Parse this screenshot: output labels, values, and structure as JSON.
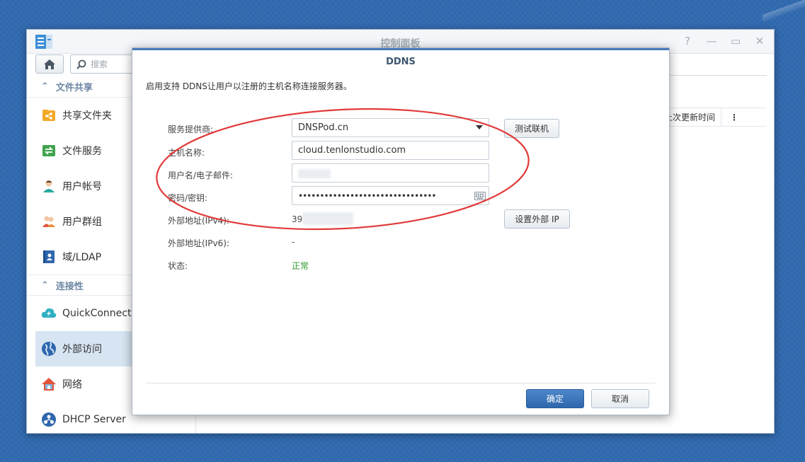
{
  "window": {
    "title": "控制面板",
    "controls": {
      "help": "?",
      "minimize": "—",
      "maximize": "▭",
      "close": "✕"
    }
  },
  "toolbar": {
    "home_icon": "home-icon",
    "search_placeholder": "搜索"
  },
  "sidebar": {
    "sections": [
      {
        "label": "文件共享",
        "items": [
          {
            "label": "共享文件夹",
            "icon": "shared-folder-icon"
          },
          {
            "label": "文件服务",
            "icon": "file-services-icon"
          },
          {
            "label": "用户帐号",
            "icon": "user-icon"
          },
          {
            "label": "用户群组",
            "icon": "group-icon"
          },
          {
            "label": "域/LDAP",
            "icon": "ldap-icon"
          }
        ]
      },
      {
        "label": "连接性",
        "items": [
          {
            "label": "QuickConnect",
            "icon": "quickconnect-icon"
          },
          {
            "label": "外部访问",
            "icon": "globe-icon",
            "active": true
          },
          {
            "label": "网络",
            "icon": "network-icon"
          },
          {
            "label": "DHCP Server",
            "icon": "dhcp-icon"
          }
        ]
      }
    ]
  },
  "main": {
    "column_header": "上次更新时间",
    "more_icon": "⋮"
  },
  "dialog": {
    "title": "DDNS",
    "description": "启用支持 DDNS让用户以注册的主机名称连接服务器。",
    "fields": {
      "provider_label": "服务提供商:",
      "provider_value": "DNSPod.cn",
      "hostname_label": "主机名称:",
      "hostname_value": "cloud.tenlonstudio.com",
      "username_label": "用户名/电子邮件:",
      "username_value": "",
      "password_label": "密码/密钥:",
      "password_value": "••••••••••••••••••••••••••••••••",
      "ipv4_label": "外部地址(IPv4):",
      "ipv4_value": "39",
      "ipv6_label": "外部地址(IPv6):",
      "ipv6_value": "-",
      "status_label": "状态:",
      "status_value": "正常"
    },
    "buttons": {
      "test_connection": "测试联机",
      "set_external_ip": "设置外部 IP",
      "ok": "确定",
      "cancel": "取消"
    },
    "colors": {
      "accent": "#2f67ad",
      "status_ok": "#2d9a2d",
      "annotation": "#e23a3a"
    }
  }
}
